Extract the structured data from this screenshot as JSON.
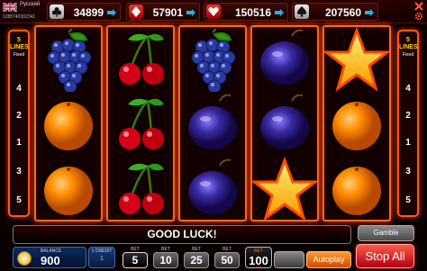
{
  "header": {
    "language": "Русский",
    "user_id": "1285740302341",
    "jackpots": [
      {
        "suit": "club",
        "value": "34899"
      },
      {
        "suit": "diamond",
        "value": "57901"
      },
      {
        "suit": "heart",
        "value": "150516"
      },
      {
        "suit": "spade",
        "value": "207560"
      }
    ]
  },
  "lines_panel": {
    "count": "5",
    "label": "LINES",
    "mode": "Fixed",
    "numbers": [
      "4",
      "2",
      "1",
      "3",
      "5"
    ]
  },
  "reels": [
    [
      "grapes",
      "orange",
      "orange"
    ],
    [
      "cherry",
      "cherry",
      "cherry"
    ],
    [
      "grapes",
      "plum",
      "plum"
    ],
    [
      "plum",
      "plum",
      "star"
    ],
    [
      "star",
      "orange",
      "orange"
    ]
  ],
  "message": "GOOD LUCK!",
  "gamble_label": "Gamble",
  "balance": {
    "label": "BALANCE",
    "value": "900"
  },
  "credit": {
    "label": "1 CREDIT",
    "value": "1"
  },
  "bet_label": "BET",
  "bet_options": [
    "5",
    "10",
    "25",
    "50"
  ],
  "selected_bet_option": "5",
  "bet": {
    "label": "BET",
    "value": "100",
    "sub": "100"
  },
  "autoplay_label": "Autoplay",
  "stop_all_label": "Stop All",
  "colors": {
    "frame": "#ff6a18",
    "accent": "#ffd800",
    "stop": "#e02020",
    "autoplay": "#ff7a10"
  }
}
